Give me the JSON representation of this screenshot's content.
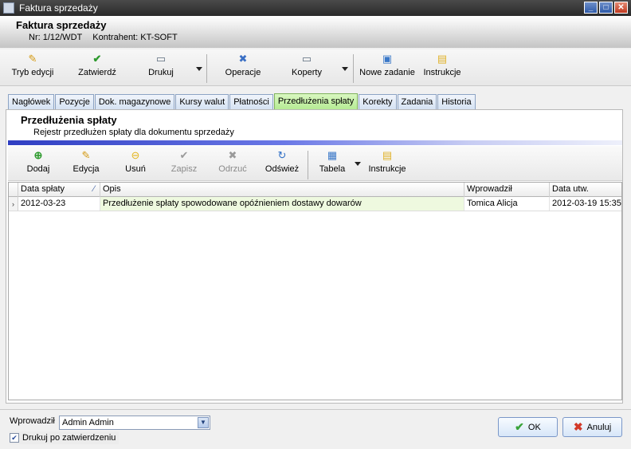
{
  "window": {
    "title": "Faktura sprzedaży"
  },
  "header": {
    "title": "Faktura sprzedaży",
    "number": "Nr: 1/12/WDT",
    "contractor": "Kontrahent: KT-SOFT"
  },
  "toolbar": {
    "edit_mode": "Tryb edycji",
    "approve": "Zatwierdź",
    "print": "Drukuj",
    "operations": "Operacje",
    "envelopes": "Koperty",
    "new_task": "Nowe zadanie",
    "instructions": "Instrukcje"
  },
  "tabs": [
    {
      "label": "Nagłówek"
    },
    {
      "label": "Pozycje"
    },
    {
      "label": "Dok. magazynowe"
    },
    {
      "label": "Kursy walut"
    },
    {
      "label": "Płatności"
    },
    {
      "label": "Przedłużenia spłaty"
    },
    {
      "label": "Korekty"
    },
    {
      "label": "Zadania"
    },
    {
      "label": "Historia"
    }
  ],
  "panel": {
    "title": "Przedłużenia spłaty",
    "subtitle": "Rejestr przedłużen spłaty dla dokumentu sprzedaży"
  },
  "subtoolbar": {
    "add": "Dodaj",
    "edit": "Edycja",
    "delete": "Usuń",
    "save": "Zapisz",
    "reject": "Odrzuć",
    "refresh": "Odśwież",
    "table": "Tabela",
    "instructions": "Instrukcje"
  },
  "grid": {
    "columns": [
      "Data spłaty",
      "Opis",
      "Wprowadził",
      "Data utw."
    ],
    "rows": [
      {
        "date": "2012-03-23",
        "description": "Przedłużenie spłaty spowodowane opóźnieniem dostawy dowarów",
        "entered_by": "Tomica Alicja",
        "created": "2012-03-19 15:35"
      }
    ]
  },
  "footer": {
    "entered_by_label": "Wprowadził",
    "entered_by_value": "Admin Admin",
    "print_after_approve": "Drukuj po zatwierdzeniu",
    "ok": "OK",
    "cancel": "Anuluj"
  }
}
